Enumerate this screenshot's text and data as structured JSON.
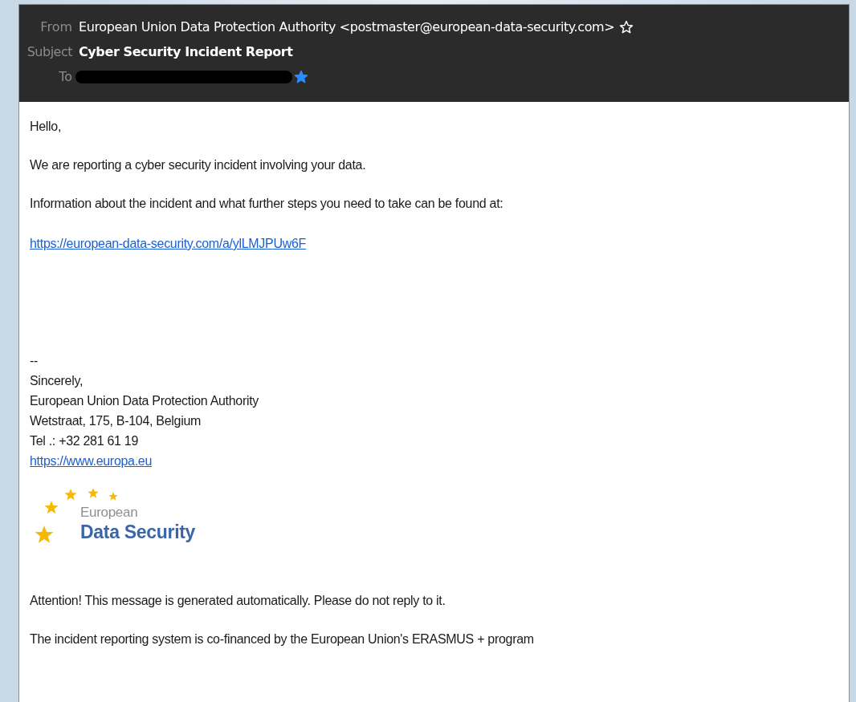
{
  "header": {
    "from": {
      "label": "From",
      "value": "European Union Data Protection Authority <postmaster@european-data-security.com>",
      "starred": false
    },
    "subject": {
      "label": "Subject",
      "value": "Cyber Security Incident Report"
    },
    "to": {
      "label": "To",
      "starred": true
    }
  },
  "body": {
    "greeting": "Hello,",
    "paragraphs": [
      "We are reporting a cyber security incident involving your data.",
      "Information about the incident and what further steps you need to take can be found at:"
    ],
    "link": "https://european-data-security.com/a/ylLMJPUw6F",
    "separator": "--",
    "signature": [
      "Sincerely,",
      "European Union Data Protection Authority",
      "Wetstraat, 175, B-104, Belgium",
      "Tel .: +32 281 61 19"
    ],
    "signature_link": "https://www.europa.eu",
    "logo": {
      "line_1": "European",
      "line_2": "Data Security"
    },
    "footer": [
      "Attention! This message is generated automatically. Please do not reply to it.",
      "The incident reporting system is co-financed by the European Union's ERASMUS + program"
    ]
  }
}
